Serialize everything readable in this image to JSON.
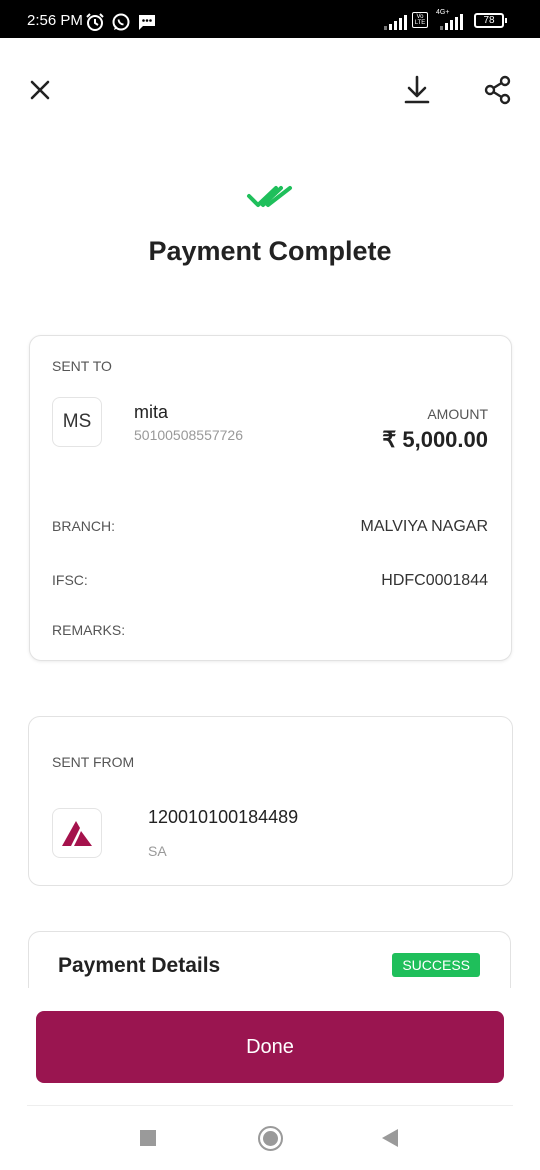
{
  "status_bar": {
    "time": "2:56 PM",
    "battery": "78",
    "volte_label": "Vo LTE",
    "network": "4G+",
    "icons": [
      "alarm-icon",
      "whatsapp-icon",
      "message-icon",
      "signal-icon",
      "battery-icon"
    ]
  },
  "header": {
    "close_icon": "close-icon",
    "download_icon": "download-icon",
    "share_icon": "share-icon"
  },
  "title": "Payment Complete",
  "accent_color": "#1fbf5b",
  "brand_color": "#9a1550",
  "sent_to": {
    "label": "SENT TO",
    "avatar_initials": "MS",
    "name": "mita",
    "account": "50100508557726",
    "amount_label": "AMOUNT",
    "amount": "₹ 5,000.00",
    "branch_label": "BRANCH:",
    "branch": "MALVIYA NAGAR",
    "ifsc_label": "IFSC:",
    "ifsc": "HDFC0001844",
    "remarks_label": "REMARKS:",
    "remarks": ""
  },
  "sent_from": {
    "label": "SENT FROM",
    "bank_logo": "axis-bank-logo",
    "account": "120010100184489",
    "account_type": "SA"
  },
  "payment_details": {
    "title": "Payment Details",
    "status": "SUCCESS"
  },
  "done_label": "Done",
  "nav": {
    "icons": [
      "recents-icon",
      "home-icon",
      "back-icon"
    ]
  }
}
